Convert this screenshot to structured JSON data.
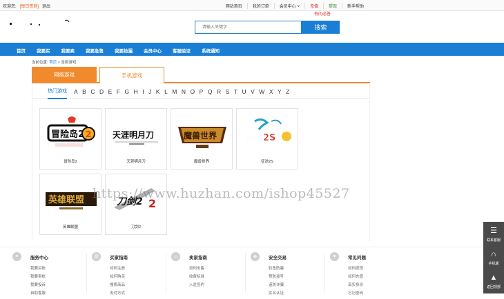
{
  "topbar": {
    "welcome": "欢迎您:",
    "brand": "[每日签到]",
    "logout": "退出",
    "links": [
      "网站首页",
      "我的订单",
      "会员中心 ˅",
      "充值",
      "提现",
      "新手帮助"
    ],
    "hotline": "有问必答"
  },
  "search": {
    "placeholder": "请输入关键字",
    "button": "搜索"
  },
  "nav": [
    "首页",
    "我要买",
    "我要卖",
    "我要急售",
    "我要捡漏",
    "会员中心",
    "客服验证",
    "系统通知"
  ],
  "breadcrumb": {
    "prefix": "当前位置:",
    "home": "首页",
    "sep": ">",
    "current": "全部游戏"
  },
  "tabs": {
    "online": "网络游戏",
    "mobile": "手机游戏"
  },
  "letters": {
    "hot": "热门游戏",
    "items": [
      "A",
      "B",
      "C",
      "D",
      "E",
      "F",
      "G",
      "H",
      "I",
      "J",
      "K",
      "L",
      "M",
      "N",
      "O",
      "P",
      "Q",
      "R",
      "S",
      "T",
      "U",
      "V",
      "W",
      "X",
      "Y",
      "Z"
    ]
  },
  "games": [
    {
      "name": "冒险岛2",
      "logo": "冒险岛2"
    },
    {
      "name": "天涯明月刀",
      "logo": "天涯明月刀"
    },
    {
      "name": "魔兽世界",
      "logo": "魔兽世界"
    },
    {
      "name": "征途2S",
      "logo": "征途2S"
    },
    {
      "name": "英雄联盟",
      "logo": "英雄联盟"
    },
    {
      "name": "刀剑2",
      "logo": "刀剑2"
    }
  ],
  "watermark": "https://www.huzhan.com/ishop45527",
  "footer": [
    {
      "title": "服务中心",
      "icon": "compass-icon",
      "links": [
        "我要买帐",
        "我要卖帐",
        "我要投诉",
        "自助客服"
      ]
    },
    {
      "title": "买家指南",
      "icon": "document-icon",
      "links": [
        "如何注册",
        "如何购买",
        "搜索商品",
        "支付方式"
      ]
    },
    {
      "title": "卖家指南",
      "icon": "monitor-icon",
      "links": [
        "如何出售",
        "收费标准",
        "入驻签约"
      ]
    },
    {
      "title": "安全交易",
      "icon": "lock-icon",
      "links": [
        "钓鱼防骗",
        "预防盗号",
        "谨防诈骗",
        "实名认证"
      ]
    },
    {
      "title": "常见问题",
      "icon": "heart-icon",
      "links": [
        "如何提现",
        "如何充值",
        "真实身份",
        "忘记密码"
      ]
    }
  ],
  "side": [
    {
      "label": "联系客服",
      "icon": "chat-icon",
      "glyph": "☰"
    },
    {
      "label": "手机版",
      "icon": "headset-icon",
      "glyph": "∩"
    },
    {
      "label": "返回顶部",
      "icon": "rocket-icon",
      "glyph": "▲"
    }
  ],
  "colors": {
    "accent": "#1a7fd4",
    "tab": "#f18a2c",
    "brand": "#e8580c"
  }
}
